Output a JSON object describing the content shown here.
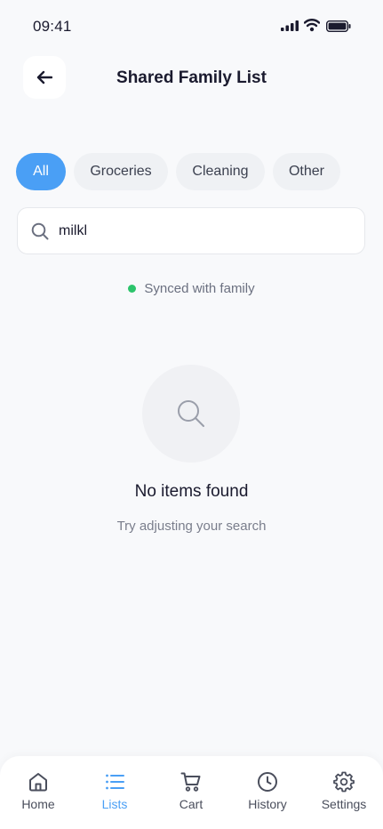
{
  "status_bar": {
    "time": "09:41",
    "icons": [
      "signal-icon",
      "wifi-icon",
      "battery-icon"
    ]
  },
  "header": {
    "title": "Shared Family List",
    "back_icon": "arrow-left-icon"
  },
  "filters": {
    "chips": [
      {
        "label": "All",
        "active": true
      },
      {
        "label": "Groceries",
        "active": false
      },
      {
        "label": "Cleaning",
        "active": false
      },
      {
        "label": "Other",
        "active": false
      }
    ]
  },
  "search": {
    "value": "milkl",
    "icon": "search-icon"
  },
  "sync": {
    "text": "Synced with family",
    "status_color": "#2cc46b"
  },
  "empty_state": {
    "icon": "search-icon",
    "title": "No items found",
    "subtitle": "Try adjusting your search"
  },
  "bottom_nav": {
    "items": [
      {
        "label": "Home",
        "icon": "home-icon",
        "active": false
      },
      {
        "label": "Lists",
        "icon": "list-icon",
        "active": true
      },
      {
        "label": "Cart",
        "icon": "cart-icon",
        "active": false
      },
      {
        "label": "History",
        "icon": "clock-icon",
        "active": false
      },
      {
        "label": "Settings",
        "icon": "gear-icon",
        "active": false
      }
    ]
  },
  "colors": {
    "accent": "#4a9ff5",
    "background": "#f8f9fb",
    "text_primary": "#1a1a2e"
  }
}
